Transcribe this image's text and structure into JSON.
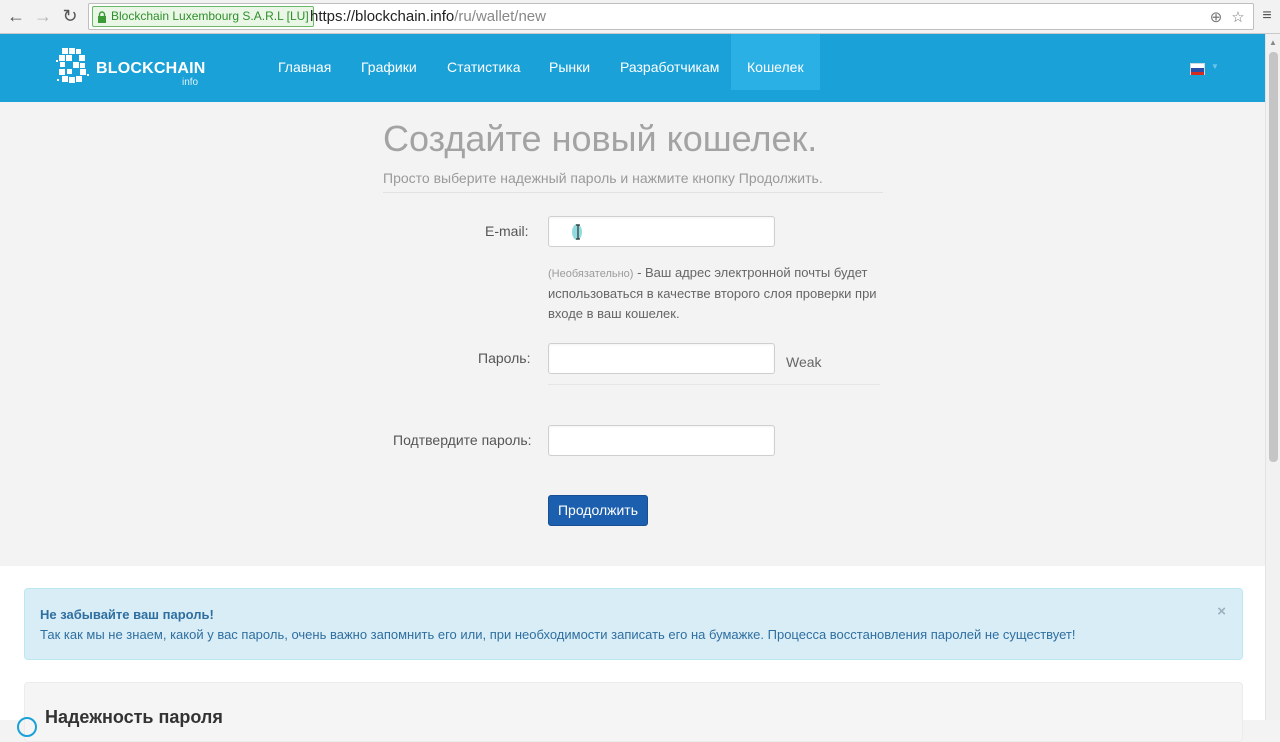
{
  "browser": {
    "ev_cert": "Blockchain Luxembourg S.A.R.L [LU]",
    "url_host": "https://blockchain.info",
    "url_path": "/ru/wallet/new"
  },
  "site": {
    "brand_name": "BLOCKCHAIN",
    "brand_sub": "info",
    "nav": [
      "Главная",
      "Графики",
      "Статистика",
      "Рынки",
      "Разработчикам",
      "Кошелек"
    ],
    "active_nav": "Кошелек"
  },
  "form": {
    "title": "Создайте новый кошелек.",
    "subtitle": "Просто выберите надежный пароль и нажмите кнопку Продолжить.",
    "email_label": "E-mail:",
    "email_value": "",
    "help_optional": "(Необязательно)",
    "help_text": " - Ваш адрес электронной почты будет использоваться в качестве второго слоя проверки при входе в ваш кошелек.",
    "password_label": "Пароль:",
    "password_value": "",
    "strength": "Weak",
    "confirm_label": "Подтвердите пароль:",
    "confirm_value": "",
    "continue_button": "Продолжить"
  },
  "alert": {
    "title": "Не забывайте ваш пароль!",
    "text": "Так как мы не знаем, какой у вас пароль, очень важно запомнить его или, при необходимости записать его на бумажке. Процесса восстановления паролей не существует!",
    "close": "×"
  },
  "panel": {
    "title": "Надежность пароля"
  },
  "colors": {
    "nav_bg": "#1aa1d8",
    "button": "#1c5fae",
    "alert_bg": "#d9edf7",
    "alert_text": "#2f6f9f"
  }
}
